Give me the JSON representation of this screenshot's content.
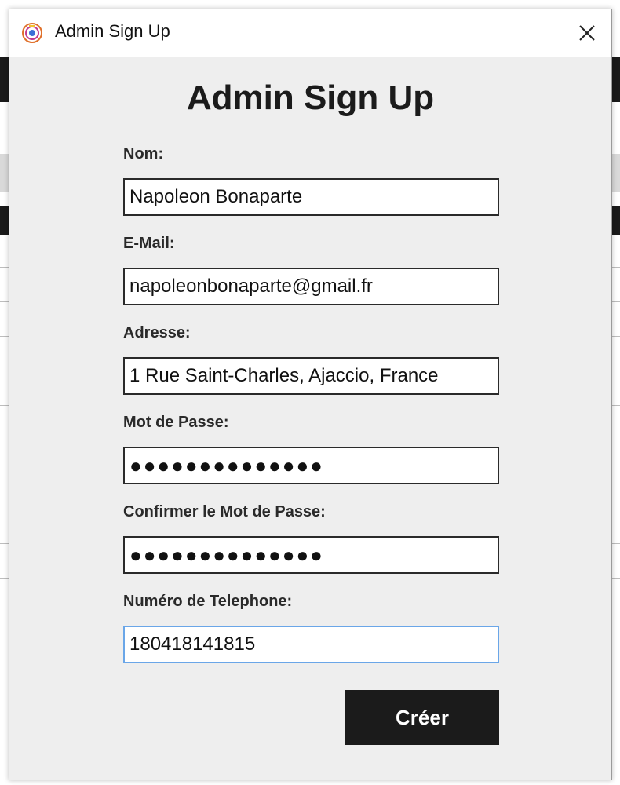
{
  "window": {
    "title": "Admin Sign Up",
    "close_symbol": "✕",
    "app_icon": "app-logo-icon"
  },
  "form": {
    "heading": "Admin Sign Up",
    "fields": [
      {
        "label": "Nom:",
        "value": "Napoleon Bonaparte",
        "type": "text"
      },
      {
        "label": "E-Mail:",
        "value": "napoleonbonaparte@gmail.fr",
        "type": "email"
      },
      {
        "label": "Adresse:",
        "value": "1 Rue Saint-Charles, Ajaccio, France",
        "type": "text"
      },
      {
        "label": "Mot de Passe:",
        "value": "●●●●●●●●●●●●●●",
        "type": "password"
      },
      {
        "label": "Confirmer le Mot de Passe:",
        "value": "●●●●●●●●●●●●●●",
        "type": "password"
      },
      {
        "label": "Numéro de Telephone:",
        "value": "180418141815",
        "type": "tel"
      }
    ],
    "submit_label": "Créer"
  },
  "colors": {
    "window_bg": "#eeeeee",
    "button_bg": "#1b1b1b",
    "focus_border": "#6aa6e8"
  }
}
